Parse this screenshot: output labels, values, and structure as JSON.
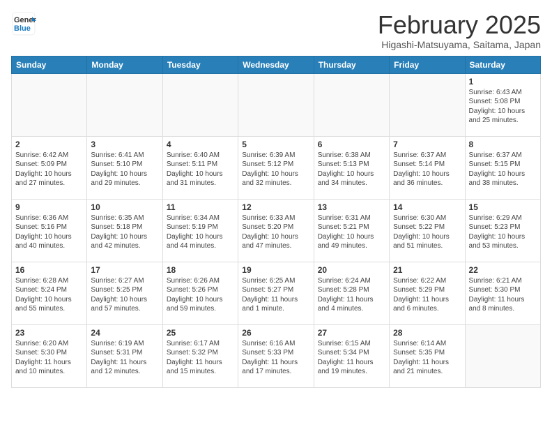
{
  "header": {
    "logo_line1": "General",
    "logo_line2": "Blue",
    "month_title": "February 2025",
    "location": "Higashi-Matsuyama, Saitama, Japan"
  },
  "weekdays": [
    "Sunday",
    "Monday",
    "Tuesday",
    "Wednesday",
    "Thursday",
    "Friday",
    "Saturday"
  ],
  "weeks": [
    [
      {
        "day": "",
        "info": ""
      },
      {
        "day": "",
        "info": ""
      },
      {
        "day": "",
        "info": ""
      },
      {
        "day": "",
        "info": ""
      },
      {
        "day": "",
        "info": ""
      },
      {
        "day": "",
        "info": ""
      },
      {
        "day": "1",
        "info": "Sunrise: 6:43 AM\nSunset: 5:08 PM\nDaylight: 10 hours and 25 minutes."
      }
    ],
    [
      {
        "day": "2",
        "info": "Sunrise: 6:42 AM\nSunset: 5:09 PM\nDaylight: 10 hours and 27 minutes."
      },
      {
        "day": "3",
        "info": "Sunrise: 6:41 AM\nSunset: 5:10 PM\nDaylight: 10 hours and 29 minutes."
      },
      {
        "day": "4",
        "info": "Sunrise: 6:40 AM\nSunset: 5:11 PM\nDaylight: 10 hours and 31 minutes."
      },
      {
        "day": "5",
        "info": "Sunrise: 6:39 AM\nSunset: 5:12 PM\nDaylight: 10 hours and 32 minutes."
      },
      {
        "day": "6",
        "info": "Sunrise: 6:38 AM\nSunset: 5:13 PM\nDaylight: 10 hours and 34 minutes."
      },
      {
        "day": "7",
        "info": "Sunrise: 6:37 AM\nSunset: 5:14 PM\nDaylight: 10 hours and 36 minutes."
      },
      {
        "day": "8",
        "info": "Sunrise: 6:37 AM\nSunset: 5:15 PM\nDaylight: 10 hours and 38 minutes."
      }
    ],
    [
      {
        "day": "9",
        "info": "Sunrise: 6:36 AM\nSunset: 5:16 PM\nDaylight: 10 hours and 40 minutes."
      },
      {
        "day": "10",
        "info": "Sunrise: 6:35 AM\nSunset: 5:18 PM\nDaylight: 10 hours and 42 minutes."
      },
      {
        "day": "11",
        "info": "Sunrise: 6:34 AM\nSunset: 5:19 PM\nDaylight: 10 hours and 44 minutes."
      },
      {
        "day": "12",
        "info": "Sunrise: 6:33 AM\nSunset: 5:20 PM\nDaylight: 10 hours and 47 minutes."
      },
      {
        "day": "13",
        "info": "Sunrise: 6:31 AM\nSunset: 5:21 PM\nDaylight: 10 hours and 49 minutes."
      },
      {
        "day": "14",
        "info": "Sunrise: 6:30 AM\nSunset: 5:22 PM\nDaylight: 10 hours and 51 minutes."
      },
      {
        "day": "15",
        "info": "Sunrise: 6:29 AM\nSunset: 5:23 PM\nDaylight: 10 hours and 53 minutes."
      }
    ],
    [
      {
        "day": "16",
        "info": "Sunrise: 6:28 AM\nSunset: 5:24 PM\nDaylight: 10 hours and 55 minutes."
      },
      {
        "day": "17",
        "info": "Sunrise: 6:27 AM\nSunset: 5:25 PM\nDaylight: 10 hours and 57 minutes."
      },
      {
        "day": "18",
        "info": "Sunrise: 6:26 AM\nSunset: 5:26 PM\nDaylight: 10 hours and 59 minutes."
      },
      {
        "day": "19",
        "info": "Sunrise: 6:25 AM\nSunset: 5:27 PM\nDaylight: 11 hours and 1 minute."
      },
      {
        "day": "20",
        "info": "Sunrise: 6:24 AM\nSunset: 5:28 PM\nDaylight: 11 hours and 4 minutes."
      },
      {
        "day": "21",
        "info": "Sunrise: 6:22 AM\nSunset: 5:29 PM\nDaylight: 11 hours and 6 minutes."
      },
      {
        "day": "22",
        "info": "Sunrise: 6:21 AM\nSunset: 5:30 PM\nDaylight: 11 hours and 8 minutes."
      }
    ],
    [
      {
        "day": "23",
        "info": "Sunrise: 6:20 AM\nSunset: 5:30 PM\nDaylight: 11 hours and 10 minutes."
      },
      {
        "day": "24",
        "info": "Sunrise: 6:19 AM\nSunset: 5:31 PM\nDaylight: 11 hours and 12 minutes."
      },
      {
        "day": "25",
        "info": "Sunrise: 6:17 AM\nSunset: 5:32 PM\nDaylight: 11 hours and 15 minutes."
      },
      {
        "day": "26",
        "info": "Sunrise: 6:16 AM\nSunset: 5:33 PM\nDaylight: 11 hours and 17 minutes."
      },
      {
        "day": "27",
        "info": "Sunrise: 6:15 AM\nSunset: 5:34 PM\nDaylight: 11 hours and 19 minutes."
      },
      {
        "day": "28",
        "info": "Sunrise: 6:14 AM\nSunset: 5:35 PM\nDaylight: 11 hours and 21 minutes."
      },
      {
        "day": "",
        "info": ""
      }
    ]
  ]
}
